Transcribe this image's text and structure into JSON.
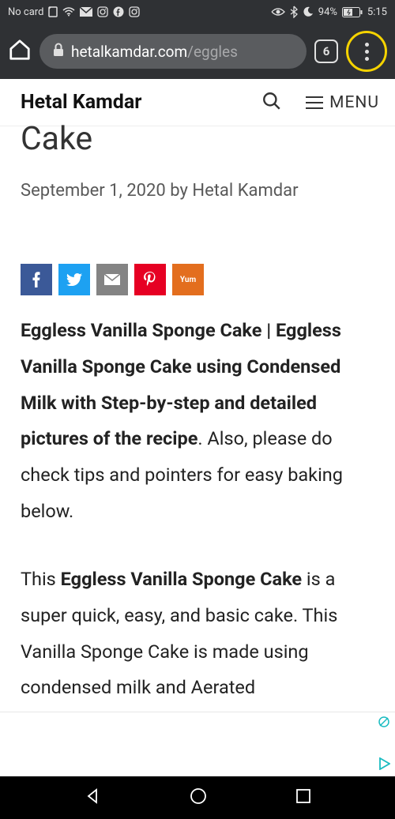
{
  "statusbar": {
    "carrier": "No card",
    "battery_pct": "94%",
    "time": "5:15"
  },
  "browser": {
    "url_domain": "hetalkamdar.com",
    "url_path": "/eggles",
    "tab_count": "6"
  },
  "siteHeader": {
    "title": "Hetal Kamdar",
    "menu_label": "MENU"
  },
  "post": {
    "title_fragment": "Cake",
    "date": "September 1, 2020",
    "by_label": "by",
    "author": "Hetal Kamdar",
    "share": {
      "yum": "Yum"
    },
    "p1_bold": "Eggless Vanilla Sponge Cake | Eggless Vanilla Sponge Cake using Condensed Milk with Step-by-step and detailed pictures of the recipe",
    "p1_rest": ". Also, please do check tips and pointers for easy baking below.",
    "p2_a": "This ",
    "p2_bold": "Eggless Vanilla Sponge Cake",
    "p2_b": " is a super quick, easy, and basic cake. This Vanilla Sponge Cake is made using condensed milk and Aerated"
  }
}
